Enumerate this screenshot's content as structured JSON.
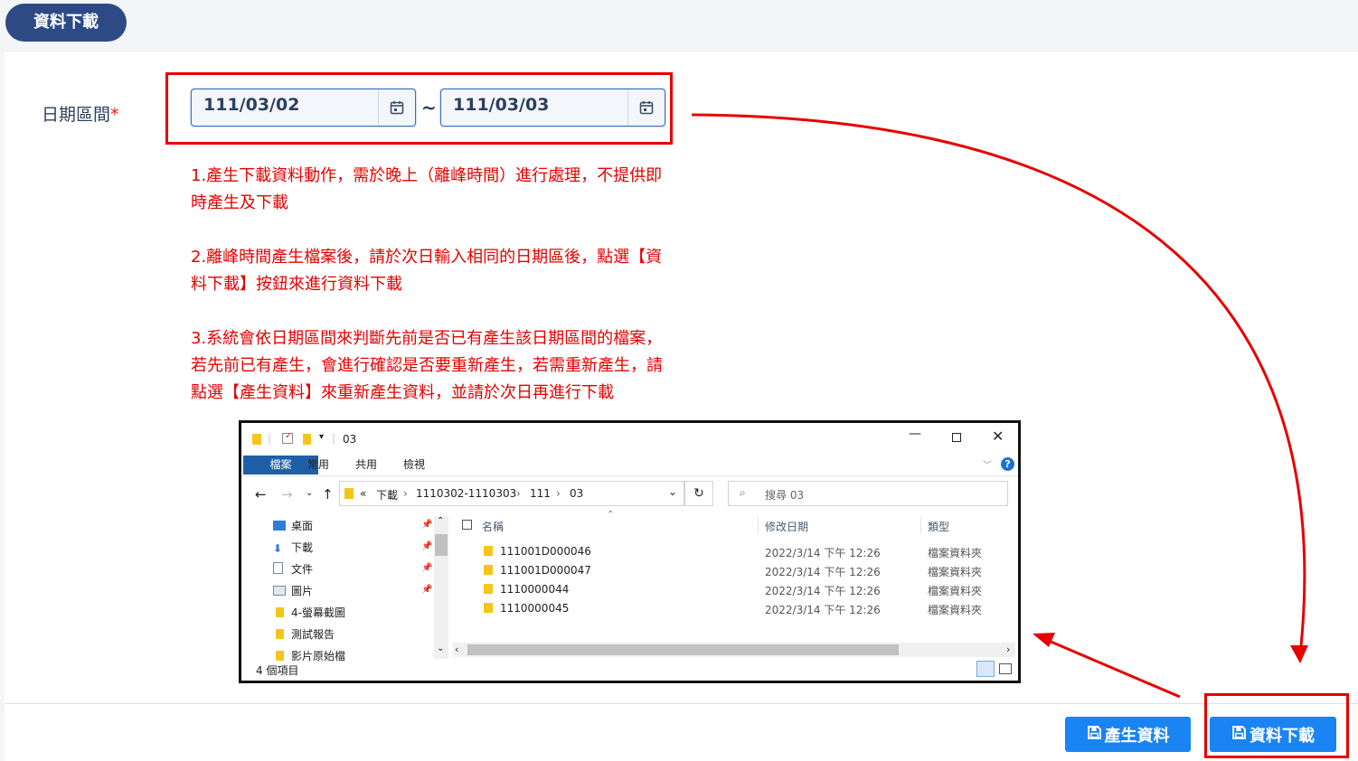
{
  "tab": {
    "label": "資料下載"
  },
  "form": {
    "date_label": "日期區間",
    "required_mark": "*",
    "date_from": "111/03/02",
    "date_to": "111/03/03",
    "separator": "~"
  },
  "notes": [
    "1.產生下載資料動作，需於晚上（離峰時間）進行處理，不提供即時產生及下載",
    "2.離峰時間產生檔案後，請於次日輸入相同的日期區後，點選【資料下載】按鈕來進行資料下載",
    "3.系統會依日期區間來判斷先前是否已有產生該日期區間的檔案，若先前已有產生，會進行確認是否要重新產生，若需重新產生，請點選【產生資料】來重新產生資料，並請於次日再進行下載"
  ],
  "buttons": {
    "generate": "產生資料",
    "download": "資料下載"
  },
  "explorer": {
    "title": "03",
    "ribbon_tabs": [
      "檔案",
      "常用",
      "共用",
      "檢視"
    ],
    "breadcrumb": [
      "«",
      "下載",
      "1110302-1110303",
      "111",
      "03"
    ],
    "search_placeholder": "搜尋 03",
    "columns": {
      "name": "名稱",
      "date": "修改日期",
      "type": "類型"
    },
    "tree": [
      {
        "label": "桌面",
        "icon": "desktop-icon",
        "pinned": true
      },
      {
        "label": "下載",
        "icon": "download-arrow-icon",
        "pinned": true
      },
      {
        "label": "文件",
        "icon": "document-icon",
        "pinned": true
      },
      {
        "label": "圖片",
        "icon": "picture-icon",
        "pinned": true
      },
      {
        "label": "4-螢幕截圖",
        "icon": "folder-icon",
        "pinned": false
      },
      {
        "label": "測試報告",
        "icon": "folder-icon",
        "pinned": false
      },
      {
        "label": "影片原始檔",
        "icon": "folder-icon",
        "pinned": false
      }
    ],
    "files": [
      {
        "name": "111001D000046",
        "date": "2022/3/14 下午 12:26",
        "type": "檔案資料夾"
      },
      {
        "name": "111001D000047",
        "date": "2022/3/14 下午 12:26",
        "type": "檔案資料夾"
      },
      {
        "name": "1110000044",
        "date": "2022/3/14 下午 12:26",
        "type": "檔案資料夾"
      },
      {
        "name": "1110000045",
        "date": "2022/3/14 下午 12:26",
        "type": "檔案資料夾"
      }
    ],
    "status": "4 個項目"
  },
  "colors": {
    "accent": "#1a84f2",
    "tab_bg": "#2d4a85",
    "annotation_red": "#e60000"
  }
}
